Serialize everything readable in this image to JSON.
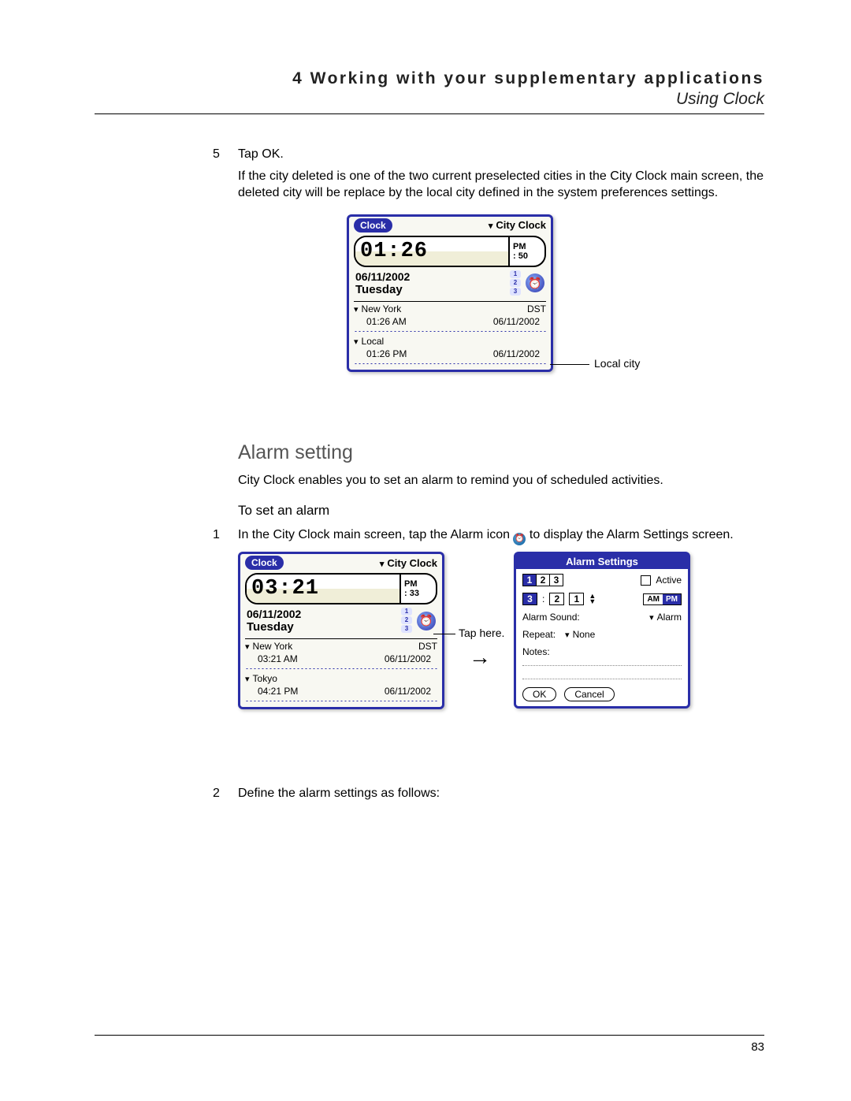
{
  "header": {
    "chapter": "4 Working with your supplementary applications",
    "section": "Using Clock"
  },
  "steps_top": {
    "num": "5",
    "text": "Tap OK.",
    "follow": "If the city deleted is one of the two current preselected cities in the City Clock main screen, the deleted city will be replace by the local city defined in the system preferences settings."
  },
  "fig1": {
    "app": "Clock",
    "menu": "City Clock",
    "time": "01:26",
    "ampm": "PM",
    "seconds": ": 50",
    "date": "06/11/2002",
    "day": "Tuesday",
    "cities": [
      {
        "name": "New York",
        "dst": "DST",
        "time": "01:26 AM",
        "date": "06/11/2002"
      },
      {
        "name": "Local",
        "dst": "",
        "time": "01:26 PM",
        "date": "06/11/2002"
      }
    ],
    "callout": "Local city"
  },
  "alarm_section": {
    "heading": "Alarm setting",
    "intro": "City Clock enables you to set an alarm to remind you of scheduled activities.",
    "subhead": "To set an alarm"
  },
  "step1": {
    "num": "1",
    "pre": "In the City Clock main screen, tap the Alarm icon ",
    "post": " to display the Alarm Settings screen."
  },
  "fig2": {
    "app": "Clock",
    "menu": "City Clock",
    "time": "03:21",
    "ampm": "PM",
    "seconds": ": 33",
    "date": "06/11/2002",
    "day": "Tuesday",
    "cities": [
      {
        "name": "New York",
        "dst": "DST",
        "time": "03:21 AM",
        "date": "06/11/2002"
      },
      {
        "name": "Tokyo",
        "dst": "",
        "time": "04:21 PM",
        "date": "06/11/2002"
      }
    ],
    "callout": "Tap here."
  },
  "alarm_panel": {
    "title": "Alarm Settings",
    "tabs": [
      "1",
      "2",
      "3"
    ],
    "tab_sel": 0,
    "active_label": "Active",
    "hour": "3",
    "min_tens": "2",
    "min_ones": "1",
    "am_label": "AM",
    "pm_label": "PM",
    "sound_label": "Alarm Sound:",
    "sound_value": "Alarm",
    "repeat_label": "Repeat:",
    "repeat_value": "None",
    "notes_label": "Notes:",
    "ok": "OK",
    "cancel": "Cancel"
  },
  "step2": {
    "num": "2",
    "text": "Define the alarm settings as follows:"
  },
  "page_number": "83"
}
